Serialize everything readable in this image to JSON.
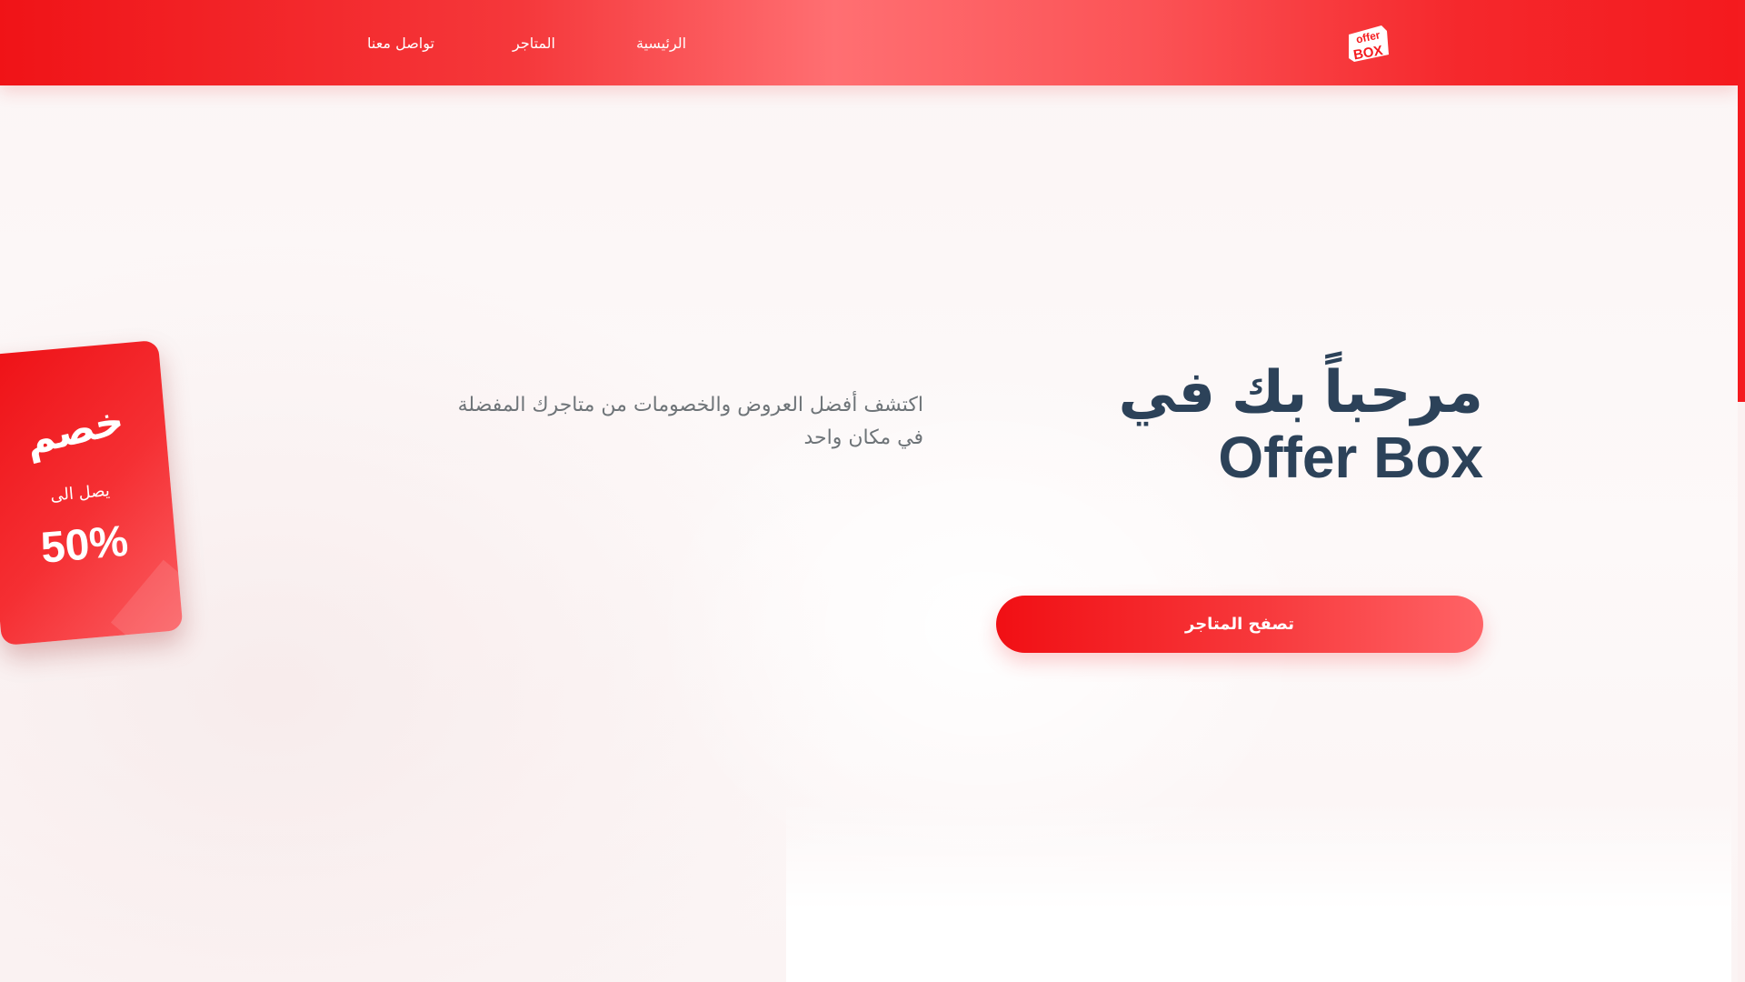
{
  "header": {
    "logo": {
      "icon": "offer-box-logo",
      "alt": "Offer Box"
    },
    "nav": {
      "home": "الرئيسية",
      "stores": "المتاجر",
      "contact": "تواصل معنا"
    }
  },
  "hero": {
    "title": "مرحباً بك في Offer Box",
    "description": "اكتشف أفضل العروض والخصومات من متاجرك المفضلة في مكان واحد",
    "cta_label": "تصفح المتاجر"
  },
  "discount_card": {
    "title": "خصم",
    "subtitle": "يصل الى",
    "value": "50%"
  },
  "colors": {
    "brand_red": "#f41b1f",
    "title_text": "#2c4259",
    "body_text": "#6e7478"
  }
}
